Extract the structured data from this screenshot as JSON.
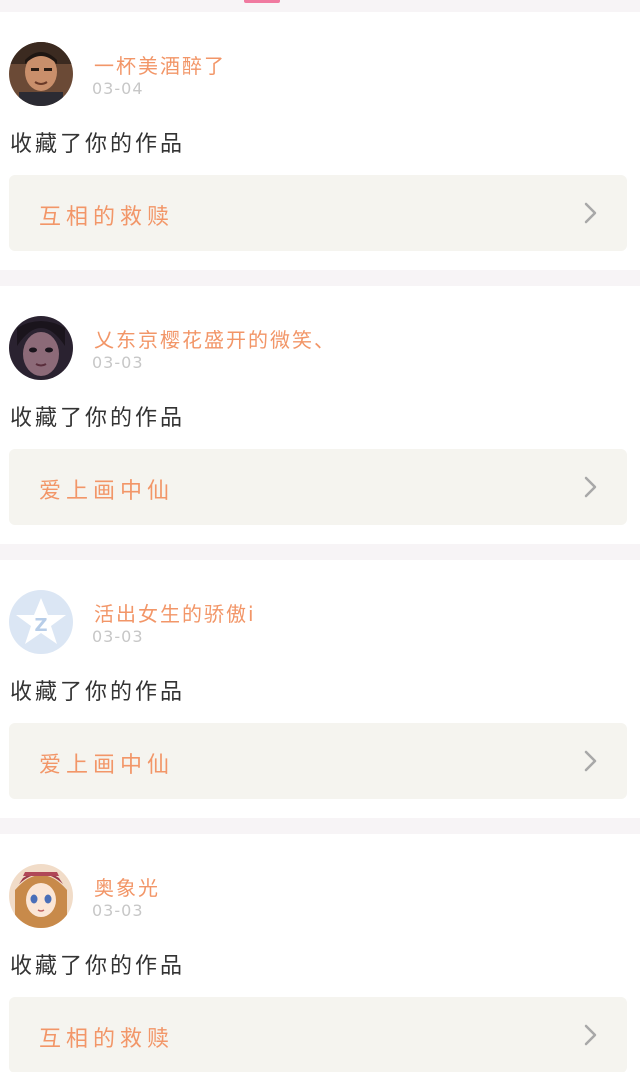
{
  "feed": [
    {
      "username": "一杯美酒醉了",
      "date": "03-04",
      "action": "收藏了你的作品",
      "work_title": "互相的救赎",
      "avatar": "man-photo-avatar"
    },
    {
      "username": "乂东京樱花盛开的微笑、",
      "date": "03-03",
      "action": "收藏了你的作品",
      "work_title": "爱上画中仙",
      "avatar": "girl-dark-photo-avatar"
    },
    {
      "username": "活出女生的骄傲i",
      "date": "03-03",
      "action": "收藏了你的作品",
      "work_title": "爱上画中仙",
      "avatar": "qzone-star-avatar"
    },
    {
      "username": "奥象光",
      "date": "03-03",
      "action": "收藏了你的作品",
      "work_title": "互相的救赎",
      "avatar": "anime-girl-avatar"
    }
  ],
  "colors": {
    "accent": "#f29668",
    "date_gray": "#c7c7c7",
    "box_bg": "#f5f4ef",
    "separator": "#f7f4f6",
    "tab_indicator": "#f07aa0"
  }
}
